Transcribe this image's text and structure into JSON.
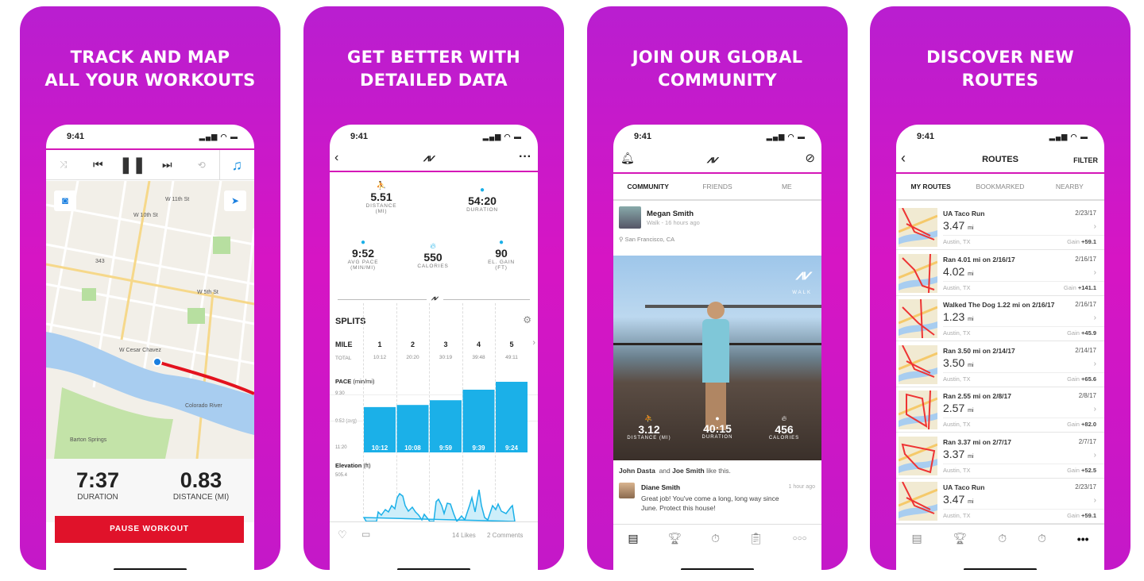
{
  "colors": {
    "brand": "#d418b8",
    "accent_blue": "#1bb0e8",
    "pause_red": "#e0122a"
  },
  "panels": [
    {
      "headline": [
        "TRACK AND MAP",
        "ALL YOUR WORKOUTS"
      ],
      "time": "9:41",
      "controls": [
        "shuffle-icon",
        "previous-icon",
        "pause-icon",
        "next-icon",
        "repeat-icon",
        "music-note-icon"
      ],
      "map_labels": [
        "W 11th St",
        "W 10th St",
        "W 5th St",
        "W Cesar Chavez",
        "Colorado River",
        "Barton Springs",
        "343"
      ],
      "duration": "7:37",
      "duration_label": "DURATION",
      "distance": "0.83",
      "distance_label": "DISTANCE (MI)",
      "button": "PAUSE WORKOUT"
    },
    {
      "headline": [
        "GET BETTER WITH",
        "DETAILED DATA"
      ],
      "time": "9:41",
      "stats": [
        {
          "value": "5.51",
          "label": "DISTANCE",
          "unit": "(MI)"
        },
        {
          "value": "54:20",
          "label": "DURATION",
          "unit": ""
        },
        {
          "value": "9:52",
          "label": "AVG PACE",
          "unit": "(MIN/MI)"
        },
        {
          "value": "550",
          "label": "CALORIES",
          "unit": ""
        },
        {
          "value": "90",
          "label": "EL. GAIN",
          "unit": "(FT)"
        }
      ],
      "splits_title": "SPLITS",
      "mile_label": "MILE",
      "miles": [
        "1",
        "2",
        "3",
        "4",
        "5"
      ],
      "total_label": "TOTAL",
      "totals": [
        "10:12",
        "20:20",
        "30:19",
        "39:48",
        "49:11"
      ],
      "pace_title": "PACE",
      "pace_unit": "(min/mi)",
      "pace_axis": [
        "9:30",
        "9:52 (avg)",
        "11:20"
      ],
      "paces": [
        "10:12",
        "10:08",
        "9:59",
        "9:39",
        "9:24"
      ],
      "elev_title": "Elevation",
      "elev_unit": "(ft)",
      "elev_max": "505.4",
      "likes": "14 Likes",
      "comments": "2 Comments"
    },
    {
      "headline": [
        "JOIN OUR GLOBAL",
        "COMMUNITY"
      ],
      "time": "9:41",
      "tabs": [
        "COMMUNITY",
        "FRIENDS",
        "ME"
      ],
      "post_user": "Megan Smith",
      "post_meta": "Walk - 16 hours ago",
      "location": "San Francisco, CA",
      "photo_tag": "WALK",
      "stats": [
        {
          "value": "3.12",
          "label": "DISTANCE (MI)"
        },
        {
          "value": "40:15",
          "label": "DURATION"
        },
        {
          "value": "456",
          "label": "CALORIES"
        }
      ],
      "likers": [
        "John Dasta",
        "Joe Smith"
      ],
      "and": "and",
      "like_text": "like this.",
      "comment_user": "Diane Smith",
      "comment_time": "1 hour ago",
      "comment_text": "Great job! You've come a long, long way since June. Protect this house!"
    },
    {
      "headline": [
        "DISCOVER NEW",
        "ROUTES"
      ],
      "time": "9:41",
      "title": "ROUTES",
      "filter": "FILTER",
      "tabs": [
        "MY ROUTES",
        "BOOKMARKED",
        "NEARBY"
      ],
      "routes": [
        {
          "name": "UA Taco Run",
          "date": "2/23/17",
          "miles": "3.47",
          "unit": "mi",
          "location": "Austin, TX",
          "gain_label": "Gain",
          "gain": "+59.1"
        },
        {
          "name": "Ran 4.01 mi on 2/16/17",
          "date": "2/16/17",
          "miles": "4.02",
          "unit": "mi",
          "location": "Austin, TX",
          "gain_label": "Gain",
          "gain": "+141.1"
        },
        {
          "name": "Walked The Dog 1.22 mi on 2/16/17",
          "date": "2/16/17",
          "miles": "1.23",
          "unit": "mi",
          "location": "Austin, TX",
          "gain_label": "Gain",
          "gain": "+45.9"
        },
        {
          "name": "Ran 3.50 mi on 2/14/17",
          "date": "2/14/17",
          "miles": "3.50",
          "unit": "mi",
          "location": "Austin, TX",
          "gain_label": "Gain",
          "gain": "+65.6"
        },
        {
          "name": "Ran 2.55 mi on 2/8/17",
          "date": "2/8/17",
          "miles": "2.57",
          "unit": "mi",
          "location": "Austin, TX",
          "gain_label": "Gain",
          "gain": "+82.0"
        },
        {
          "name": "Ran 3.37 mi on 2/7/17",
          "date": "2/7/17",
          "miles": "3.37",
          "unit": "mi",
          "location": "Austin, TX",
          "gain_label": "Gain",
          "gain": "+52.5"
        },
        {
          "name": "UA Taco Run",
          "date": "2/23/17",
          "miles": "3.47",
          "unit": "mi",
          "location": "Austin, TX",
          "gain_label": "Gain",
          "gain": "+59.1"
        }
      ]
    }
  ]
}
